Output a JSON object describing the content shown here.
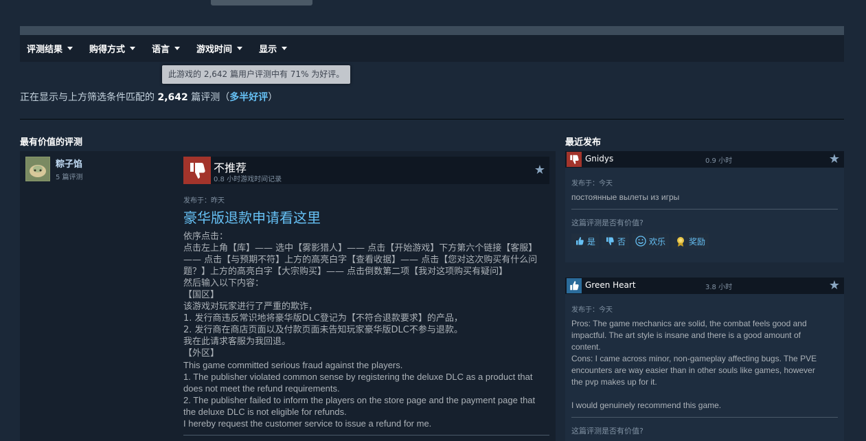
{
  "filters": [
    {
      "label": "评测结果"
    },
    {
      "label": "购得方式"
    },
    {
      "label": "语言"
    },
    {
      "label": "游戏时间"
    },
    {
      "label": "显示"
    }
  ],
  "tooltip": "此游戏的 2,642 篇用户评测中有 71% 为好评。",
  "summary": {
    "prefix": "正在显示与上方筛选条件匹配的 ",
    "count": "2,642",
    "suffix": " 篇评测（",
    "rating": "多半好评",
    "close": "）"
  },
  "sections": {
    "most_helpful": "最有价值的评测",
    "recent": "最近发布"
  },
  "main_review": {
    "author": "粽子馅",
    "author_reviews": "5 篇评测",
    "verdict": "不推荐",
    "hours": "0.8 小时游戏时间记录",
    "posted": "发布于：昨天",
    "title": "豪华版退款申请看这里",
    "body_lines": [
      "依序点击：",
      "点击左上角【库】—— 选中【雾影猎人】—— 点击【开始游戏】下方第六个链接【客服】",
      "—— 点击【与预期不符】上方的高亮白字【查看收据】—— 点击【您对这次购买有什么问",
      "题？】上方的高亮白字【大宗购买】—— 点击倒数第二项【我对这项购买有疑问】",
      "然后输入以下内容：",
      "【国区】",
      "该游戏对玩家进行了严重的欺诈，",
      "1. 发行商违反常识地将豪华版DLC登记为【不符合退款要求】的产品，",
      "2. 发行商在商店页面以及付款页面未告知玩家豪华版DLC不参与退款。",
      "我在此请求客服为我回退。",
      "【外区】"
    ],
    "body_en_lines": [
      "This game committed serious fraud against the players.",
      "1. The publisher violated common sense by registering the deluxe DLC as a product that",
      "does not meet the refund requirements.",
      "2. The publisher failed to inform the players on the store page and the payment page that",
      "the deluxe DLC is not eligible for refunds.",
      "I hereby request the customer service to issue a refund for me."
    ]
  },
  "recent_reviews": [
    {
      "author": "Gnidys",
      "hours": "0.9 小时",
      "posted": "发布于：今天",
      "text_lines": [
        "постоянные вылеты из игры"
      ],
      "helpful_prompt": "这篇评测是否有价值?",
      "buttons": {
        "yes": "是",
        "no": "否",
        "funny": "欢乐",
        "award": "奖励"
      }
    },
    {
      "author": "Green Heart",
      "hours": "3.8 小时",
      "posted": "发布于：今天",
      "text_lines": [
        "Pros: The game mechanics are solid, the combat feels good and",
        "impactful. The art style is insane and there is a good amount of",
        "content.",
        "Cons: I came across minor, non-gameplay affecting bugs. The PVE",
        "encounters are way easier than in other souls like games, however",
        "the pvp makes up for it.",
        "",
        "I would genuinely recommend this game."
      ],
      "helpful_prompt": "这篇评测是否有价值?"
    }
  ],
  "colors": {
    "background": "#1b2838",
    "accent": "#66c0f4",
    "negative": "#a3342b"
  }
}
